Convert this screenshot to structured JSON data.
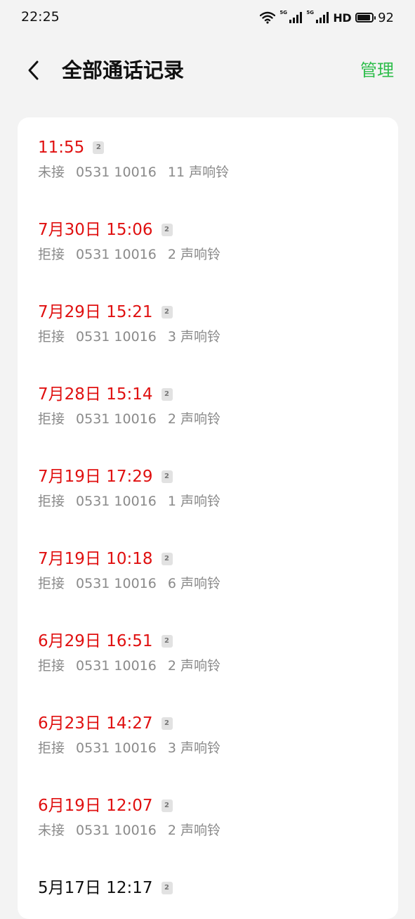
{
  "status_bar": {
    "time": "22:25",
    "network_tag_1": "5G",
    "network_tag_2": "5G",
    "hd_label": "HD",
    "battery_level": 92,
    "battery_text": "92"
  },
  "header": {
    "title": "全部通话记录",
    "action_label": "管理",
    "accent_color": "#2ebd4b"
  },
  "call_records": [
    {
      "time": "11:55",
      "sim": "2",
      "type": "未接",
      "number": "0531 10016",
      "rings": "11 声响铃",
      "missed": true
    },
    {
      "time": "7月30日 15:06",
      "sim": "2",
      "type": "拒接",
      "number": "0531 10016",
      "rings": "2 声响铃",
      "missed": true
    },
    {
      "time": "7月29日 15:21",
      "sim": "2",
      "type": "拒接",
      "number": "0531 10016",
      "rings": "3 声响铃",
      "missed": true
    },
    {
      "time": "7月28日 15:14",
      "sim": "2",
      "type": "拒接",
      "number": "0531 10016",
      "rings": "2 声响铃",
      "missed": true
    },
    {
      "time": "7月19日 17:29",
      "sim": "2",
      "type": "拒接",
      "number": "0531 10016",
      "rings": "1 声响铃",
      "missed": true
    },
    {
      "time": "7月19日 10:18",
      "sim": "2",
      "type": "拒接",
      "number": "0531 10016",
      "rings": "6 声响铃",
      "missed": true
    },
    {
      "time": "6月29日 16:51",
      "sim": "2",
      "type": "拒接",
      "number": "0531 10016",
      "rings": "2 声响铃",
      "missed": true
    },
    {
      "time": "6月23日 14:27",
      "sim": "2",
      "type": "拒接",
      "number": "0531 10016",
      "rings": "3 声响铃",
      "missed": true
    },
    {
      "time": "6月19日 12:07",
      "sim": "2",
      "type": "未接",
      "number": "0531 10016",
      "rings": "2 声响铃",
      "missed": true
    },
    {
      "time": "5月17日 12:17",
      "sim": "2",
      "type": "",
      "number": "",
      "rings": "",
      "missed": false
    }
  ],
  "colors": {
    "missed": "#e01010",
    "normal": "#111111",
    "detail": "#8a8a8a"
  }
}
